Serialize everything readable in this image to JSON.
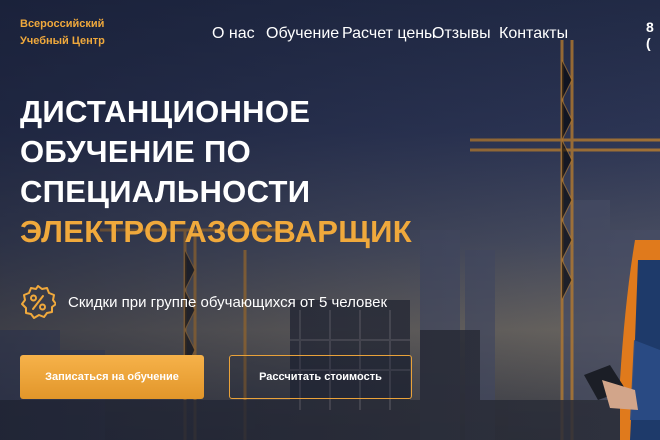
{
  "brand": {
    "line1": "Всероссийский",
    "line2": "Учебный Центр"
  },
  "nav": {
    "items": [
      "О нас",
      "Обучение",
      "Расчет цены",
      "Отзывы",
      "Контакты"
    ]
  },
  "phone": "8 (",
  "hero": {
    "line1": "Дистанционное",
    "line2": "обучение по",
    "line3": "специальности",
    "line4": "Электрогазосварщик"
  },
  "discount": {
    "text": "Скидки при группе обучающихся от 5 человек",
    "icon": "percent-badge-icon"
  },
  "buttons": {
    "enroll": "Записаться на обучение",
    "calculate": "Рассчитать стоимость"
  },
  "colors": {
    "accent": "#f0a93c",
    "background": "#222b47"
  }
}
